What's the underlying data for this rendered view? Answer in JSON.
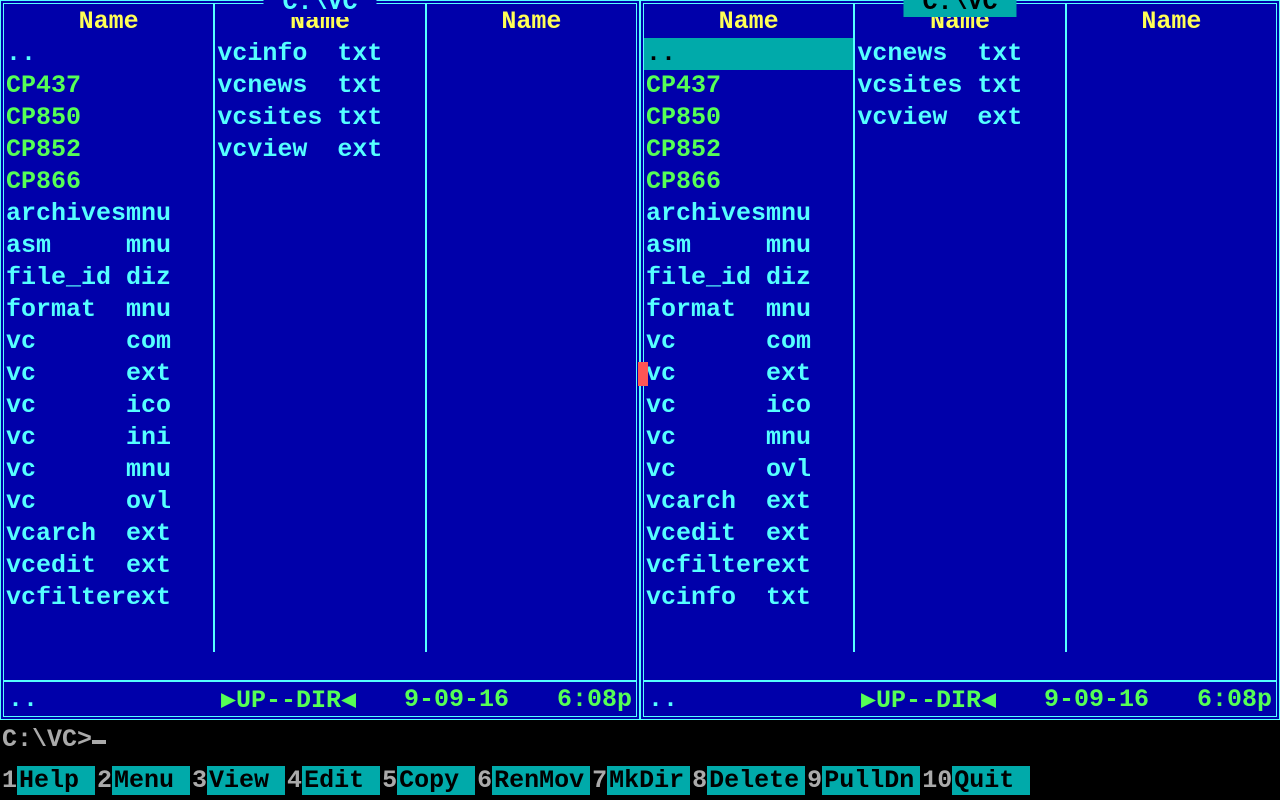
{
  "colors": {
    "bg": "#0000AA",
    "frame": "#55FFFF",
    "header": "#FFFF55",
    "file": "#55FFFF",
    "dir": "#55FF55",
    "sel_bg": "#00AAAA",
    "marker": "#FF5555"
  },
  "column_header": "Name",
  "left": {
    "title": " C:\\VC ",
    "active": false,
    "cols": [
      [
        {
          "name": "..",
          "ext": "",
          "dir": true,
          "up": true
        },
        {
          "name": "CP437",
          "ext": "",
          "dir": true
        },
        {
          "name": "CP850",
          "ext": "",
          "dir": true
        },
        {
          "name": "CP852",
          "ext": "",
          "dir": true
        },
        {
          "name": "CP866",
          "ext": "",
          "dir": true
        },
        {
          "name": "archives",
          "ext": "mnu"
        },
        {
          "name": "asm",
          "ext": "mnu"
        },
        {
          "name": "file_id",
          "ext": "diz"
        },
        {
          "name": "format",
          "ext": "mnu"
        },
        {
          "name": "vc",
          "ext": "com"
        },
        {
          "name": "vc",
          "ext": "ext"
        },
        {
          "name": "vc",
          "ext": "ico"
        },
        {
          "name": "vc",
          "ext": "ini"
        },
        {
          "name": "vc",
          "ext": "mnu"
        },
        {
          "name": "vc",
          "ext": "ovl"
        },
        {
          "name": "vcarch",
          "ext": "ext"
        },
        {
          "name": "vcedit",
          "ext": "ext"
        },
        {
          "name": "vcfilter",
          "ext": "ext"
        }
      ],
      [
        {
          "name": "vcinfo",
          "ext": "txt"
        },
        {
          "name": "vcnews",
          "ext": "txt"
        },
        {
          "name": "vcsites",
          "ext": "txt"
        },
        {
          "name": "vcview",
          "ext": "ext"
        }
      ],
      []
    ],
    "mini": {
      "name": "..",
      "size": "▶UP--DIR◀",
      "date": " 9-09-16",
      "time": " 6:08p"
    }
  },
  "right": {
    "title": " C:\\VC ",
    "active": true,
    "selected": [
      0,
      0
    ],
    "marker": [
      0,
      10
    ],
    "cols": [
      [
        {
          "name": "..",
          "ext": "",
          "dir": true,
          "up": true
        },
        {
          "name": "CP437",
          "ext": "",
          "dir": true
        },
        {
          "name": "CP850",
          "ext": "",
          "dir": true
        },
        {
          "name": "CP852",
          "ext": "",
          "dir": true
        },
        {
          "name": "CP866",
          "ext": "",
          "dir": true
        },
        {
          "name": "archives",
          "ext": "mnu"
        },
        {
          "name": "asm",
          "ext": "mnu"
        },
        {
          "name": "file_id",
          "ext": "diz"
        },
        {
          "name": "format",
          "ext": "mnu"
        },
        {
          "name": "vc",
          "ext": "com"
        },
        {
          "name": "vc",
          "ext": "ext"
        },
        {
          "name": "vc",
          "ext": "ico"
        },
        {
          "name": "vc",
          "ext": "mnu"
        },
        {
          "name": "vc",
          "ext": "ovl"
        },
        {
          "name": "vcarch",
          "ext": "ext"
        },
        {
          "name": "vcedit",
          "ext": "ext"
        },
        {
          "name": "vcfilter",
          "ext": "ext"
        },
        {
          "name": "vcinfo",
          "ext": "txt"
        }
      ],
      [
        {
          "name": "vcnews",
          "ext": "txt"
        },
        {
          "name": "vcsites",
          "ext": "txt"
        },
        {
          "name": "vcview",
          "ext": "ext"
        }
      ],
      []
    ],
    "mini": {
      "name": "..",
      "size": "▶UP--DIR◀",
      "date": " 9-09-16",
      "time": " 6:08p"
    }
  },
  "cmdline": "C:\\VC>",
  "fkeys": [
    {
      "n": "1",
      "l": "Help"
    },
    {
      "n": "2",
      "l": "Menu"
    },
    {
      "n": "3",
      "l": "View"
    },
    {
      "n": "4",
      "l": "Edit"
    },
    {
      "n": "5",
      "l": "Copy"
    },
    {
      "n": "6",
      "l": "RenMov"
    },
    {
      "n": "7",
      "l": "MkDir"
    },
    {
      "n": "8",
      "l": "Delete"
    },
    {
      "n": "9",
      "l": "PullDn"
    },
    {
      "n": "10",
      "l": "Quit"
    }
  ]
}
